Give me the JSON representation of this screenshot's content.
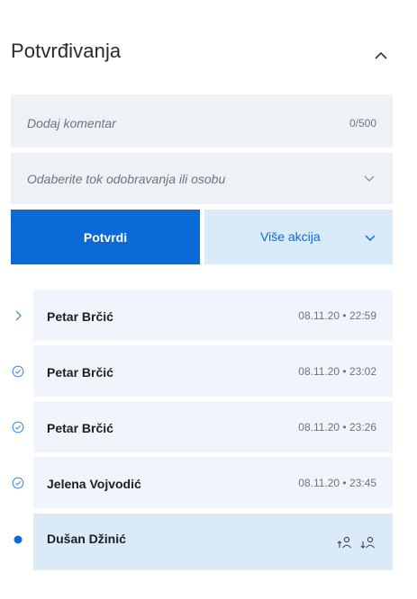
{
  "panel": {
    "title": "Potvrđivanja",
    "collapse_icon": "chevron-up-icon"
  },
  "comment": {
    "placeholder": "Dodaj komentar",
    "counter": "0/500"
  },
  "flow_select": {
    "placeholder": "Odaberite tok odobravanja ili osobu",
    "icon": "chevron-down-icon"
  },
  "actions": {
    "confirm_label": "Potvrdi",
    "more_label": "Više akcija",
    "more_icon": "chevron-down-icon"
  },
  "timeline": [
    {
      "name": "Petar Brčić",
      "time": "08.11.20 • 22:59",
      "status": "current-arrow",
      "icon": "chevron-right-icon"
    },
    {
      "name": "Petar Brčić",
      "time": "08.11.20 • 23:02",
      "status": "done",
      "icon": "check-circle-icon"
    },
    {
      "name": "Petar Brčić",
      "time": "08.11.20 • 23:26",
      "status": "done",
      "icon": "check-circle-icon"
    },
    {
      "name": "Jelena Vojvodić",
      "time": "08.11.20 • 23:45",
      "status": "done",
      "icon": "check-circle-icon"
    },
    {
      "name": "Dušan Džinić",
      "time": "",
      "status": "pending",
      "icon": "filled-dot-icon",
      "actions": [
        "move-up-user-icon",
        "move-down-user-icon"
      ]
    }
  ],
  "colors": {
    "primary": "#0a6bd8",
    "primary_light": "#d9ebfa",
    "field_bg": "#eef1f5",
    "card_bg": "#f0f5fb",
    "card_active_bg": "#dbeaf8"
  }
}
